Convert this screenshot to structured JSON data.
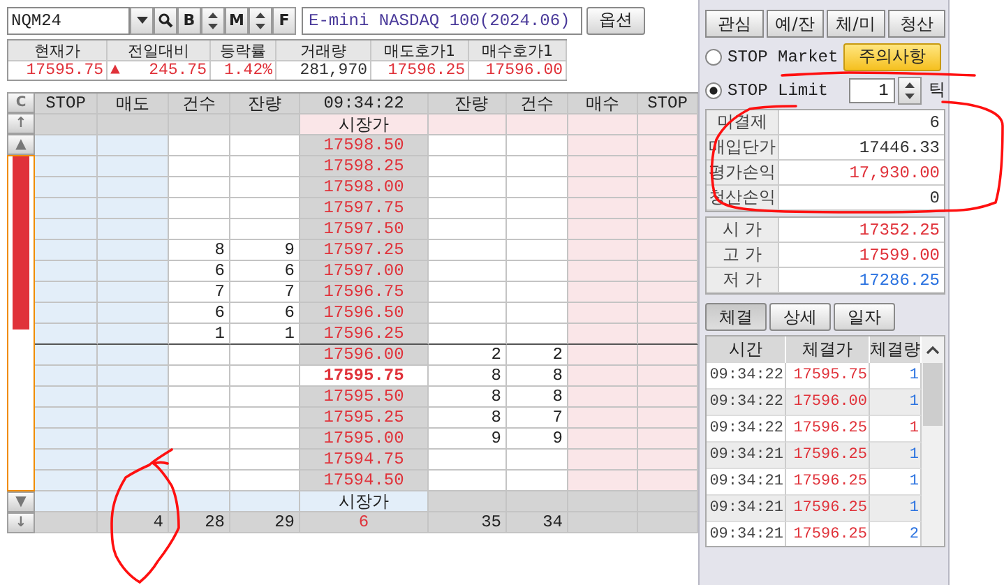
{
  "symbol_bar": {
    "code": "NQM24",
    "name": "E-mini NASDAQ 100(2024.06)",
    "option_button": "옵션",
    "tool_buttons": [
      "B",
      "M",
      "F"
    ]
  },
  "quote": {
    "columns": [
      "현재가",
      "전일대비",
      "등락률",
      "거래량",
      "매도호가1",
      "매수호가1"
    ],
    "values": [
      {
        "text": "17595.75",
        "color": "#e0323a"
      },
      {
        "text": "245.75",
        "color": "#e0323a",
        "arrow": "▲"
      },
      {
        "text": "1.42%",
        "color": "#e0323a"
      },
      {
        "text": "281,970",
        "color": "#333333"
      },
      {
        "text": "17596.25",
        "color": "#e0323a"
      },
      {
        "text": "17596.00",
        "color": "#e0323a"
      }
    ]
  },
  "order_book": {
    "columns": [
      "STOP",
      "매도",
      "건수",
      "잔량",
      "09:34:22",
      "잔량",
      "건수",
      "매수",
      "STOP"
    ],
    "side_buttons": {
      "clear": "C",
      "top": "↑",
      "up": "▲",
      "down": "▼",
      "bottom": "↓"
    },
    "ratio_bar": {
      "level": 0.52
    },
    "market_top": "시장가",
    "rows": [
      {
        "price": "17598.50",
        "current": false
      },
      {
        "price": "17598.25",
        "current": false
      },
      {
        "price": "17598.00",
        "current": false
      },
      {
        "price": "17597.75",
        "current": false
      },
      {
        "price": "17597.50",
        "current": false
      },
      {
        "price": "17597.25",
        "sell_count": "8",
        "sell_qty": "9",
        "current": false
      },
      {
        "price": "17597.00",
        "sell_count": "6",
        "sell_qty": "6",
        "current": false
      },
      {
        "price": "17596.75",
        "sell_count": "7",
        "sell_qty": "7",
        "current": false
      },
      {
        "price": "17596.50",
        "sell_count": "6",
        "sell_qty": "6",
        "current": false
      },
      {
        "price": "17596.25",
        "sell_count": "1",
        "sell_qty": "1",
        "current": false
      },
      {
        "price": "17596.00",
        "buy_qty": "2",
        "buy_count": "2",
        "current": false
      },
      {
        "price": "17595.75",
        "buy_qty": "8",
        "buy_count": "8",
        "current": true
      },
      {
        "price": "17595.50",
        "buy_qty": "8",
        "buy_count": "8",
        "current": false
      },
      {
        "price": "17595.25",
        "buy_qty": "8",
        "buy_count": "7",
        "current": false
      },
      {
        "price": "17595.00",
        "buy_qty": "9",
        "buy_count": "9",
        "current": false
      },
      {
        "price": "17594.75",
        "current": false
      },
      {
        "price": "17594.50",
        "current": false
      }
    ],
    "market_bottom": "시장가",
    "totals": {
      "sell": "4",
      "sell_count": "28",
      "sell_qty": "29",
      "price": "6",
      "buy_qty": "35",
      "buy_count": "34"
    }
  },
  "side_panel": {
    "buttons": [
      "관심",
      "예/잔",
      "체/미",
      "청산"
    ],
    "stop_types": [
      {
        "label": "STOP Market",
        "selected": false
      },
      {
        "label": "STOP Limit",
        "selected": true
      }
    ],
    "warning_button": "주의사항",
    "tick": {
      "value": "1",
      "unit": "틱"
    },
    "position": [
      {
        "label": "미결제",
        "value": "6",
        "color": "#333333"
      },
      {
        "label": "매입단가",
        "value": "17446.33",
        "color": "#333333"
      },
      {
        "label": "평가손익",
        "value": "17,930.00",
        "color": "#e0323a"
      },
      {
        "label": "청산손익",
        "value": "0",
        "color": "#333333"
      }
    ],
    "prices": [
      {
        "label": "시 가",
        "value": "17352.25",
        "color": "#e0323a"
      },
      {
        "label": "고 가",
        "value": "17599.00",
        "color": "#e0323a"
      },
      {
        "label": "저 가",
        "value": "17286.25",
        "color": "#2a72e0"
      }
    ],
    "trade_tabs": [
      {
        "label": "체결",
        "selected": true
      },
      {
        "label": "상세",
        "selected": false
      },
      {
        "label": "일자",
        "selected": false
      }
    ],
    "trades": {
      "columns": [
        "시간",
        "체결가",
        "체결량"
      ],
      "rows": [
        {
          "time": "09:34:22",
          "price": "17595.75",
          "qty": "1",
          "color": "#2a72e0"
        },
        {
          "time": "09:34:22",
          "price": "17596.00",
          "qty": "1",
          "color": "#2a72e0"
        },
        {
          "time": "09:34:22",
          "price": "17596.25",
          "qty": "1",
          "color": "#e0323a"
        },
        {
          "time": "09:34:21",
          "price": "17596.25",
          "qty": "1",
          "color": "#2a72e0"
        },
        {
          "time": "09:34:21",
          "price": "17596.25",
          "qty": "1",
          "color": "#2a72e0"
        },
        {
          "time": "09:34:21",
          "price": "17596.25",
          "qty": "1",
          "color": "#2a72e0"
        },
        {
          "time": "09:34:21",
          "price": "17596.25",
          "qty": "2",
          "color": "#2a72e0"
        }
      ]
    }
  }
}
